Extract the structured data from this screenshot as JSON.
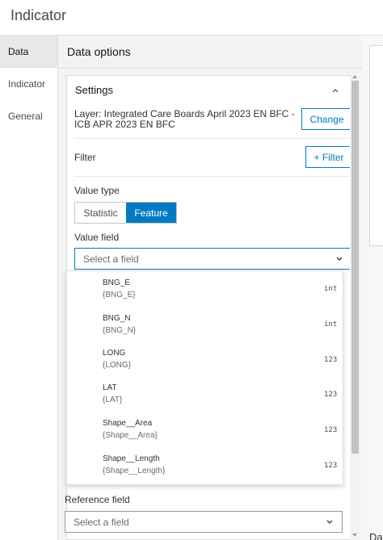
{
  "title": "Indicator",
  "nav": {
    "items": [
      {
        "label": "Data",
        "active": true
      },
      {
        "label": "Indicator",
        "active": false
      },
      {
        "label": "General",
        "active": false
      }
    ]
  },
  "panel": {
    "header": "Data options",
    "settings": {
      "heading": "Settings",
      "layer_text": "Layer: Integrated Care Boards April 2023 EN BFC - ICB APR 2023 EN BFC",
      "change_label": "Change",
      "filter_label": "Filter",
      "filter_button": "+ Filter",
      "value_type_label": "Value type",
      "value_type_options": [
        "Statistic",
        "Feature"
      ],
      "value_type_selected": "Feature",
      "value_field_label": "Value field",
      "value_field_placeholder": "Select a field"
    },
    "dropdown_fields": [
      {
        "name": "BNG_E",
        "alias": "{BNG_E}",
        "type": "int"
      },
      {
        "name": "BNG_N",
        "alias": "{BNG_N}",
        "type": "int"
      },
      {
        "name": "LONG",
        "alias": "{LONG}",
        "type": "123"
      },
      {
        "name": "LAT",
        "alias": "{LAT}",
        "type": "123"
      },
      {
        "name": "Shape__Area",
        "alias": "{Shape__Area}",
        "type": "123"
      },
      {
        "name": "Shape__Length",
        "alias": "{Shape__Length}",
        "type": "123"
      }
    ],
    "reference_field_label": "Reference field",
    "reference_field_placeholder": "Select a field"
  },
  "preview": {
    "cut_text": "Da"
  },
  "colors": {
    "accent": "#007ac2",
    "nav_active_bg": "#e8e8e8",
    "panel_bg": "#f3f3f3"
  }
}
